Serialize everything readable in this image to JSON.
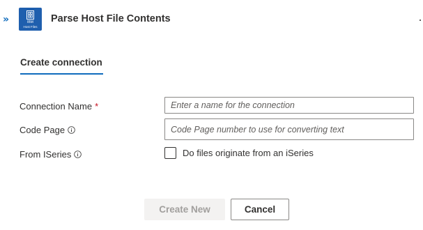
{
  "header": {
    "expand_glyph": "»",
    "expand_icon": "double-chevron-right-icon",
    "app_icon": {
      "line1": "IBM",
      "line2": "Host Files",
      "color": "#1f5fae"
    },
    "title": "Parse Host File Contents"
  },
  "tabs": [
    {
      "label": "Create connection",
      "active": true
    }
  ],
  "form": {
    "connection_name": {
      "label": "Connection Name",
      "required_mark": "*",
      "value": "",
      "placeholder": "Enter a name for the connection"
    },
    "code_page": {
      "label": "Code Page",
      "info_icon": "info-icon",
      "value": "",
      "placeholder": "Code Page number to use for converting text"
    },
    "from_iseries": {
      "label": "From ISeries",
      "info_icon": "info-icon",
      "checked": false,
      "checkbox_label": "Do files originate from an iSeries"
    }
  },
  "buttons": {
    "create_new": "Create New",
    "create_new_disabled": true,
    "cancel": "Cancel"
  },
  "colors": {
    "accent": "#0f6cbd",
    "required": "#c50f1f",
    "text": "#323130",
    "placeholder": "#605e5c",
    "disabled_bg": "#f3f2f1",
    "disabled_text": "#a19f9d"
  }
}
